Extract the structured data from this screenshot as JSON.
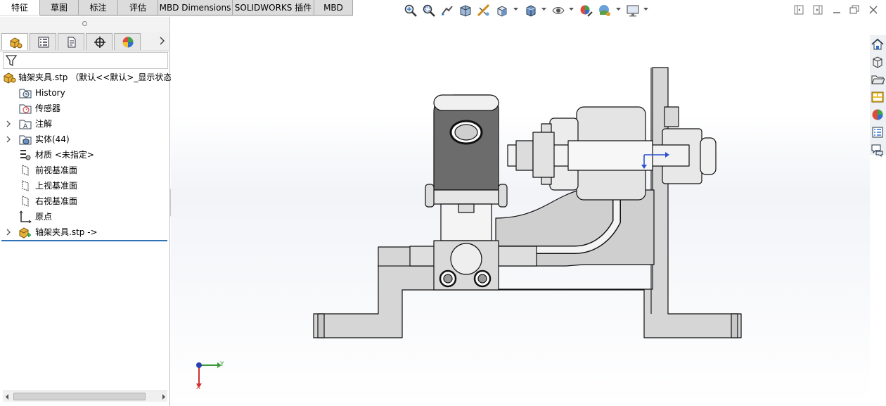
{
  "command_tabs": [
    "特征",
    "草图",
    "标注",
    "评估",
    "MBD Dimensions",
    "SOLIDWORKS 插件",
    "MBD"
  ],
  "active_tab": "特征",
  "view_toolbar_icons": [
    "zoom-to-fit-icon",
    "zoom-to-area-icon",
    "previous-view-icon",
    "section-view-icon",
    "dynamic-annotation-view-icon",
    "view-orientation-icon",
    "display-style-icon",
    "hide-show-items-icon",
    "edit-appearance-icon",
    "apply-scene-icon",
    "view-settings-icon"
  ],
  "window_controls": [
    "tile-left-icon",
    "tile-right-icon",
    "minimize-icon",
    "restore-icon",
    "close-icon"
  ],
  "manager_tabs": [
    "featuremanager-tree-icon",
    "propertymanager-icon",
    "configurationmanager-icon",
    "dimxpertmanager-icon",
    "displaymanager-icon"
  ],
  "tree": {
    "root": "轴架夹具.stp （默认<<默认>_显示状态",
    "items": [
      {
        "label": "History",
        "icon": "history-folder-icon",
        "expandable": false
      },
      {
        "label": "传感器",
        "icon": "sensors-folder-icon",
        "expandable": false
      },
      {
        "label": "注解",
        "icon": "annotations-folder-icon",
        "expandable": true
      },
      {
        "label": "实体(44)",
        "icon": "solid-bodies-folder-icon",
        "expandable": true
      },
      {
        "label": "材质 <未指定>",
        "icon": "material-icon",
        "expandable": false
      },
      {
        "label": "前视基准面",
        "icon": "plane-icon",
        "expandable": false
      },
      {
        "label": "上视基准面",
        "icon": "plane-icon",
        "expandable": false
      },
      {
        "label": "右视基准面",
        "icon": "plane-icon",
        "expandable": false
      },
      {
        "label": "原点",
        "icon": "origin-icon",
        "expandable": false
      },
      {
        "label": "轴架夹具.stp ->",
        "icon": "imported-part-icon",
        "expandable": true
      }
    ]
  },
  "triad": {
    "x_label": "X",
    "y_label": "Y"
  },
  "task_pane_icons": [
    "solidworks-resources-icon",
    "design-library-icon",
    "file-explorer-icon",
    "view-palette-icon",
    "appearances-scenes-icon",
    "custom-properties-icon",
    "forum-icon"
  ],
  "colors": {
    "active_tab_bg": "#ffffff",
    "tab_bg": "#dcdcdc",
    "rollback_bar": "#2f72b5",
    "model_face": "#d4d4d4",
    "model_dark": "#6c6c6c"
  }
}
